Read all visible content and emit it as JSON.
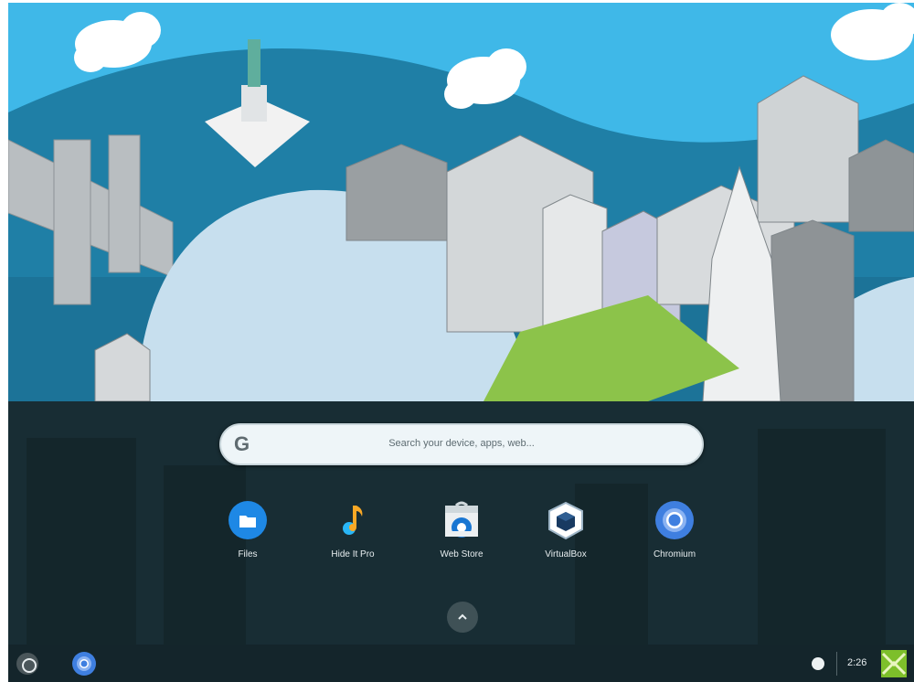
{
  "search": {
    "logo": "G",
    "placeholder": "Search your device, apps, web..."
  },
  "apps": [
    {
      "label": "Files",
      "icon": "files-icon",
      "color": "#1e88e5"
    },
    {
      "label": "Hide It Pro",
      "icon": "music-note-icon",
      "color": "#f9a825"
    },
    {
      "label": "Web Store",
      "icon": "web-store-icon",
      "color": "#1976d2"
    },
    {
      "label": "VirtualBox",
      "icon": "virtualbox-icon",
      "color": "#183a61"
    },
    {
      "label": "Chromium",
      "icon": "chromium-icon",
      "color": "#3f7fe0"
    }
  ],
  "shelf": {
    "clock": "2:26",
    "status_icons": [
      "network-icon"
    ]
  },
  "colors": {
    "sky": "#3fb8e8",
    "hill": "#1f7fa6",
    "launcher_bg": "#18282c",
    "accent": "#4285f4"
  }
}
